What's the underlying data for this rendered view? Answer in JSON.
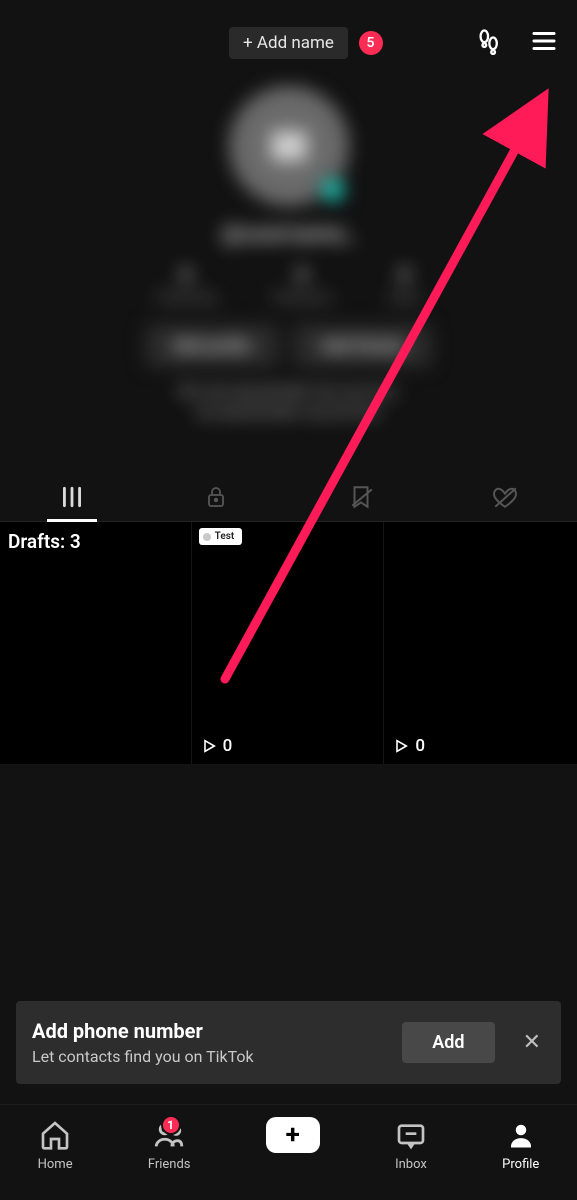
{
  "header": {
    "add_name_label": "+ Add name",
    "notif_count": "5"
  },
  "profile": {
    "username": "@username_",
    "stats": [
      {
        "value": "0",
        "label": "Following"
      },
      {
        "value": "0",
        "label": "Followers"
      },
      {
        "value": "0",
        "label": "Likes"
      }
    ],
    "edit_label": "Edit profile",
    "add_friends_label": "Add friends",
    "bio_line1": "Bio text placeholder line, bio text,",
    "bio_line2": "bio placeholder second line"
  },
  "grid": {
    "drafts_label": "Drafts: 3",
    "test_label": "Test",
    "view_count_1": "0",
    "view_count_2": "0"
  },
  "prompt": {
    "title": "Add phone number",
    "subtitle": "Let contacts find you on TikTok",
    "button": "Add"
  },
  "nav": {
    "home": "Home",
    "friends": "Friends",
    "friends_badge": "1",
    "inbox": "Inbox",
    "profile": "Profile"
  }
}
